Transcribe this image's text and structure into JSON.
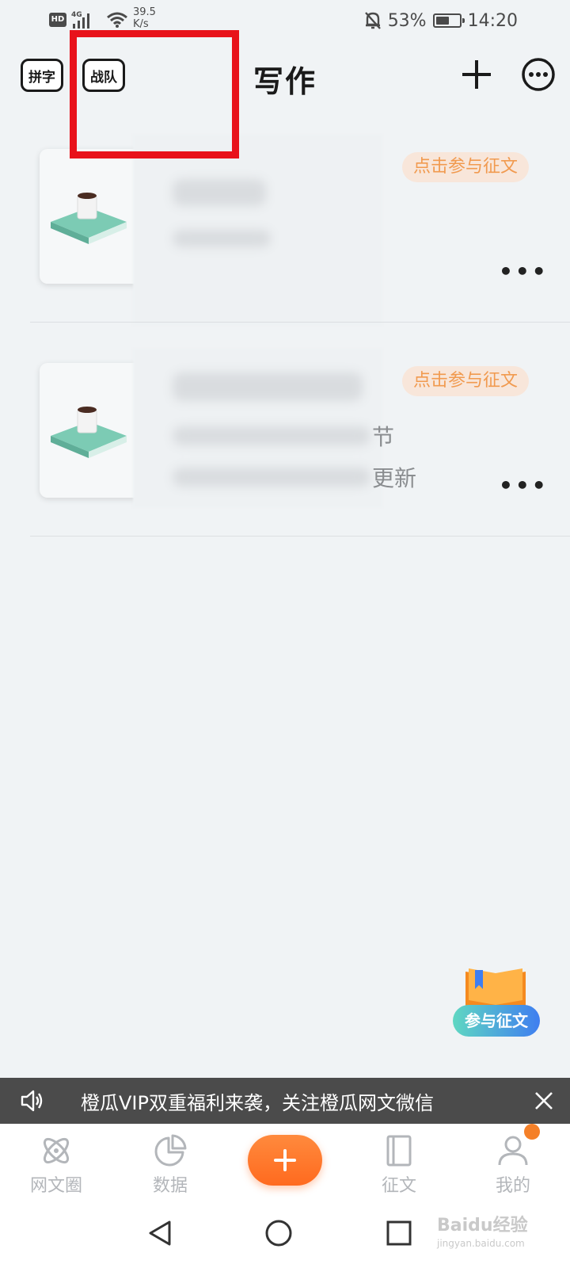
{
  "status_bar": {
    "hd": "HD",
    "network": "4G",
    "speed_value": "39.5",
    "speed_unit": "K/s",
    "battery": "53%",
    "time": "14:20"
  },
  "header": {
    "pinzi_label": "拼字",
    "zhandui_label": "战队",
    "title": "写作"
  },
  "works": [
    {
      "badge": "点击参与征文",
      "visible_fragments": []
    },
    {
      "badge": "点击参与征文",
      "visible_fragments": [
        "节",
        "更新"
      ]
    }
  ],
  "float_promo": {
    "label": "参与征文"
  },
  "notice": {
    "text": "橙瓜VIP双重福利来袭，关注橙瓜网文微信"
  },
  "bottom_nav": {
    "items": [
      {
        "label": "网文圈",
        "icon": "atom-icon"
      },
      {
        "label": "数据",
        "icon": "pie-chart-icon"
      },
      {
        "label": "征文",
        "icon": "book-icon"
      },
      {
        "label": "我的",
        "icon": "user-icon"
      }
    ]
  },
  "watermark": {
    "brand": "Baidu经验",
    "url": "jingyan.baidu.com"
  },
  "colors": {
    "accent": "#ff6a1f",
    "badge_bg": "#f8e6da",
    "badge_text": "#f19a4f",
    "highlight": "#e8121b",
    "background": "#f0f3f5"
  }
}
